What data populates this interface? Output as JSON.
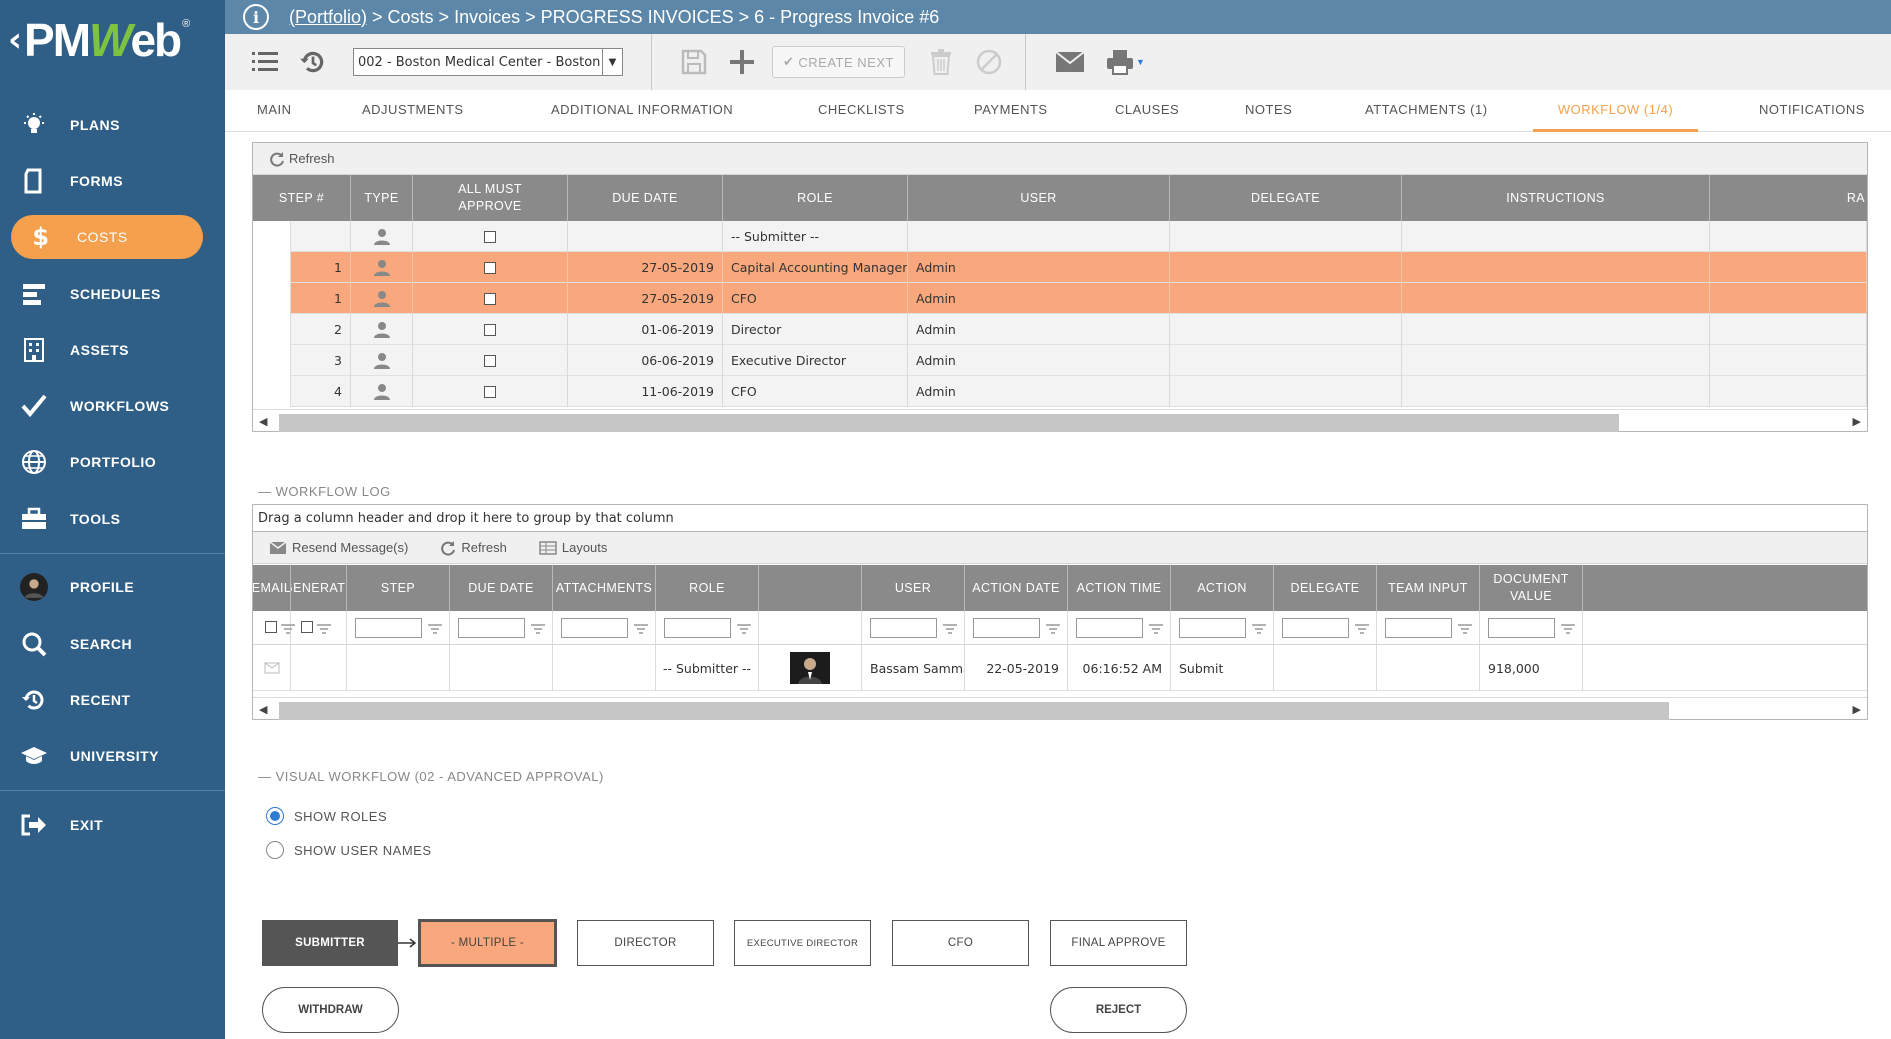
{
  "logo": {
    "text_a": "PM",
    "text_b": "W",
    "text_c": "eb",
    "reg": "®"
  },
  "sidebar": {
    "items": [
      {
        "label": "PLANS",
        "icon": "lightbulb-icon"
      },
      {
        "label": "FORMS",
        "icon": "document-icon"
      },
      {
        "label": "COSTS",
        "icon": "dollar-icon"
      },
      {
        "label": "SCHEDULES",
        "icon": "schedule-bars-icon"
      },
      {
        "label": "ASSETS",
        "icon": "building-icon"
      },
      {
        "label": "WORKFLOWS",
        "icon": "checkmark-icon"
      },
      {
        "label": "PORTFOLIO",
        "icon": "globe-icon"
      },
      {
        "label": "TOOLS",
        "icon": "toolbox-icon"
      },
      {
        "label": "PROFILE",
        "icon": "avatar"
      },
      {
        "label": "SEARCH",
        "icon": "search-icon"
      },
      {
        "label": "RECENT",
        "icon": "history-icon"
      },
      {
        "label": "UNIVERSITY",
        "icon": "graduation-cap-icon"
      },
      {
        "label": "EXIT",
        "icon": "exit-icon"
      }
    ],
    "active": "COSTS"
  },
  "breadcrumb": {
    "portfolio": "(Portfolio)",
    "rest": " > Costs > Invoices > PROGRESS INVOICES > 6 - Progress Invoice #6"
  },
  "toolbar": {
    "project": "002 - Boston Medical Center - Boston",
    "create_next": "CREATE NEXT"
  },
  "tabs": [
    {
      "label": "MAIN"
    },
    {
      "label": "ADJUSTMENTS"
    },
    {
      "label": "ADDITIONAL INFORMATION"
    },
    {
      "label": "CHECKLISTS"
    },
    {
      "label": "PAYMENTS"
    },
    {
      "label": "CLAUSES"
    },
    {
      "label": "NOTES"
    },
    {
      "label": "ATTACHMENTS (1)"
    },
    {
      "label": "WORKFLOW (1/4)"
    },
    {
      "label": "NOTIFICATIONS"
    }
  ],
  "workflow_grid": {
    "refresh": "Refresh",
    "headers": [
      "STEP #",
      "TYPE",
      "ALL MUST APPROVE",
      "DUE DATE",
      "ROLE",
      "USER",
      "DELEGATE",
      "INSTRUCTIONS",
      "RA"
    ],
    "rows": [
      {
        "step": "",
        "due": "",
        "role": "-- Submitter --",
        "user": "",
        "style": "grey"
      },
      {
        "step": "1",
        "due": "27-05-2019",
        "role": "Capital Accounting Manager",
        "user": "Admin",
        "style": "hl"
      },
      {
        "step": "1",
        "due": "27-05-2019",
        "role": "CFO",
        "user": "Admin",
        "style": "hl"
      },
      {
        "step": "2",
        "due": "01-06-2019",
        "role": "Director",
        "user": "Admin",
        "style": "grey"
      },
      {
        "step": "3",
        "due": "06-06-2019",
        "role": "Executive Director",
        "user": "Admin",
        "style": "grey"
      },
      {
        "step": "4",
        "due": "11-06-2019",
        "role": "CFO",
        "user": "Admin",
        "style": "grey"
      }
    ]
  },
  "workflow_log": {
    "title": "WORKFLOW LOG",
    "group_hint": "Drag a column header and drop it here to group by that column",
    "resend": "Resend Message(s)",
    "refresh": "Refresh",
    "layouts": "Layouts",
    "headers": [
      "EMAIL",
      "GENERATE",
      "STEP",
      "DUE DATE",
      "ATTACHMENTS",
      "ROLE",
      "",
      "USER",
      "ACTION DATE",
      "ACTION TIME",
      "ACTION",
      "DELEGATE",
      "TEAM INPUT",
      "DOCUMENT VALUE"
    ],
    "row": {
      "role": "-- Submitter --",
      "user": "Bassam Samman",
      "action_date": "22-05-2019",
      "action_time": "06:16:52 AM",
      "action": "Submit",
      "document_value": "918,000"
    }
  },
  "visual_workflow": {
    "title": "VISUAL WORKFLOW (02 - ADVANCED APPROVAL)",
    "show_roles": "SHOW ROLES",
    "show_user_names": "SHOW USER NAMES",
    "selected": "SHOW ROLES",
    "nodes": [
      "SUBMITTER",
      "- MULTIPLE -",
      "DIRECTOR",
      "EXECUTIVE DIRECTOR",
      "CFO",
      "FINAL APPROVE"
    ],
    "withdraw": "WITHDRAW",
    "reject": "REJECT"
  },
  "colors": {
    "sidebar": "#2f5f86",
    "accent": "#f5a04c",
    "highlight_row": "#f9a77c",
    "header_grey": "#8a8a8a"
  }
}
